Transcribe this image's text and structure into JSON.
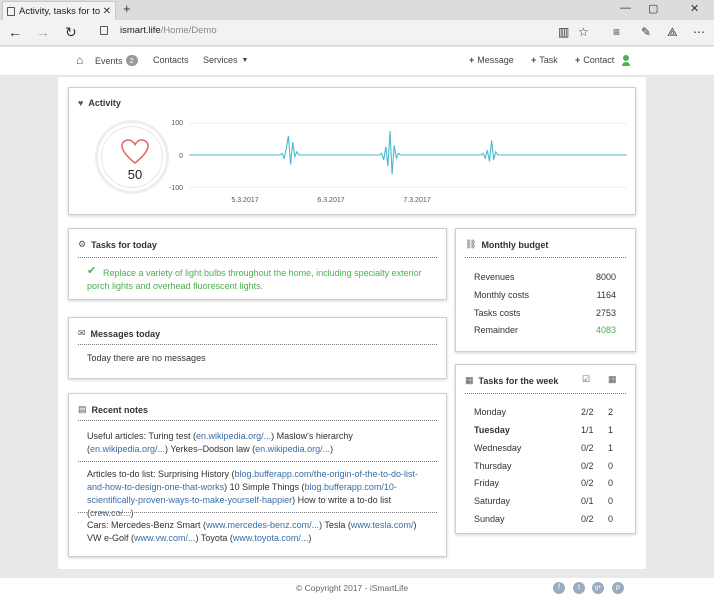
{
  "browser": {
    "tab_title": "Activity, tasks for today,",
    "url_host": "ismart.life",
    "url_path": "/Home/Demo"
  },
  "header": {
    "events_label": "Events",
    "events_count": "2",
    "contacts_label": "Contacts",
    "services_label": "Services",
    "message_label": "Message",
    "task_label": "Task",
    "contact_label": "Contact"
  },
  "activity": {
    "title": "Activity",
    "heart_value": "50"
  },
  "chart_data": {
    "type": "line",
    "ylim": [
      -100,
      100
    ],
    "y_ticks": [
      "100",
      "0",
      "-100"
    ],
    "x_labels": [
      "5.3.2017",
      "6.3.2017",
      "7.3.2017"
    ],
    "color": "#4ab8cf",
    "series": [
      {
        "values": [
          0,
          0,
          0,
          0,
          0,
          0,
          0,
          0,
          0,
          0,
          0,
          0,
          0,
          0,
          0,
          0,
          0,
          0,
          0,
          0,
          0,
          0,
          0,
          0,
          0,
          0,
          0,
          0,
          0,
          0,
          0,
          0,
          0,
          0,
          0,
          0,
          0,
          0,
          0,
          0,
          0,
          0,
          0,
          0,
          5,
          -10,
          20,
          60,
          -30,
          40,
          -5,
          10,
          0,
          0,
          0,
          0,
          0,
          0,
          0,
          0,
          0,
          0,
          0,
          0,
          0,
          0,
          0,
          0,
          0,
          0,
          0,
          0,
          0,
          0,
          0,
          0,
          0,
          0,
          0,
          0,
          0,
          0,
          0,
          0,
          0,
          0,
          0,
          0,
          0,
          0,
          0,
          5,
          -15,
          25,
          -35,
          75,
          -60,
          30,
          -10,
          5,
          0,
          0,
          0,
          0,
          0,
          0,
          0,
          0,
          0,
          0,
          0,
          0,
          0,
          0,
          0,
          0,
          0,
          0,
          0,
          0,
          0,
          0,
          0,
          0,
          0,
          0,
          0,
          0,
          0,
          0,
          0,
          0,
          0,
          0,
          0,
          0,
          0,
          0,
          0,
          5,
          -10,
          15,
          -20,
          45,
          -15,
          10,
          0,
          0,
          0,
          0,
          0,
          0,
          0,
          0,
          0,
          0,
          0,
          0,
          0,
          0,
          0,
          0,
          0,
          0,
          0,
          0,
          0,
          0,
          0,
          0,
          0,
          0,
          0,
          0,
          0,
          0,
          0,
          0,
          0,
          0,
          0,
          0,
          0,
          0,
          0,
          0,
          0,
          0,
          0,
          0,
          0,
          0,
          0,
          0,
          0,
          0,
          0,
          0,
          0,
          0,
          0,
          0,
          0,
          0,
          0,
          0,
          0,
          0
        ]
      }
    ]
  },
  "tasks_today": {
    "title": "Tasks for today",
    "items": [
      "Replace a variety of light bulbs throughout the home, including specialty exterior porch lights and overhead fluorescent lights."
    ]
  },
  "messages": {
    "title": "Messages today",
    "text": "Today there are no messages"
  },
  "notes": {
    "title": "Recent notes",
    "n1_a": "Useful articles: Turing test (",
    "n1_l1": "en.wikipedia.org/...",
    "n1_b": ") Maslow's hierarchy (",
    "n1_l2": "en.wikipedia.org/...",
    "n1_c": ") Yerkes–Dodson law (",
    "n1_l3": "en.wikipedia.org/...",
    "n1_d": ")",
    "n2_a": "Articles to-do list: Surprising History (",
    "n2_l1": "blog.bufferapp.com/the-origin-of-the-to-do-list-and-how-to-design-one-that-works",
    "n2_b": ") 10 Simple Things (",
    "n2_l2": "blog.bufferapp.com/10-scientifically-proven-ways-to-make-yourself-happier",
    "n2_c": ") How to write a to-do list (",
    "n2_l3": "crew.co/...",
    "n2_d": ")",
    "n3_a": "Cars: Mercedes-Benz Smart (",
    "n3_l1": "www.mercedes-benz.com/...",
    "n3_b": ") Tesla (",
    "n3_l2": "www.tesla.com/",
    "n3_c": ") VW e-Golf (",
    "n3_l3": "www.vw.com/...",
    "n3_d": ") Toyota (",
    "n3_l4": "www.toyota.com/...",
    "n3_e": ")"
  },
  "budget": {
    "title": "Monthly budget",
    "rows": [
      {
        "label": "Revenues",
        "value": "8000"
      },
      {
        "label": "Monthly costs",
        "value": "1164"
      },
      {
        "label": "Tasks costs",
        "value": "2753"
      },
      {
        "label": "Remainder",
        "value": "4083"
      }
    ]
  },
  "week": {
    "title": "Tasks for the week",
    "rows": [
      {
        "day": "Monday",
        "a": "2/2",
        "b": "2"
      },
      {
        "day": "Tuesday",
        "a": "1/1",
        "b": "1"
      },
      {
        "day": "Wednesday",
        "a": "0/2",
        "b": "1"
      },
      {
        "day": "Thursday",
        "a": "0/2",
        "b": "0"
      },
      {
        "day": "Friday",
        "a": "0/2",
        "b": "0"
      },
      {
        "day": "Saturday",
        "a": "0/1",
        "b": "0"
      },
      {
        "day": "Sunday",
        "a": "0/2",
        "b": "0"
      }
    ]
  },
  "footer": {
    "copyright": "© Copyright 2017 - iSmartLife",
    "social": [
      "f",
      "t",
      "g+",
      "p"
    ]
  }
}
